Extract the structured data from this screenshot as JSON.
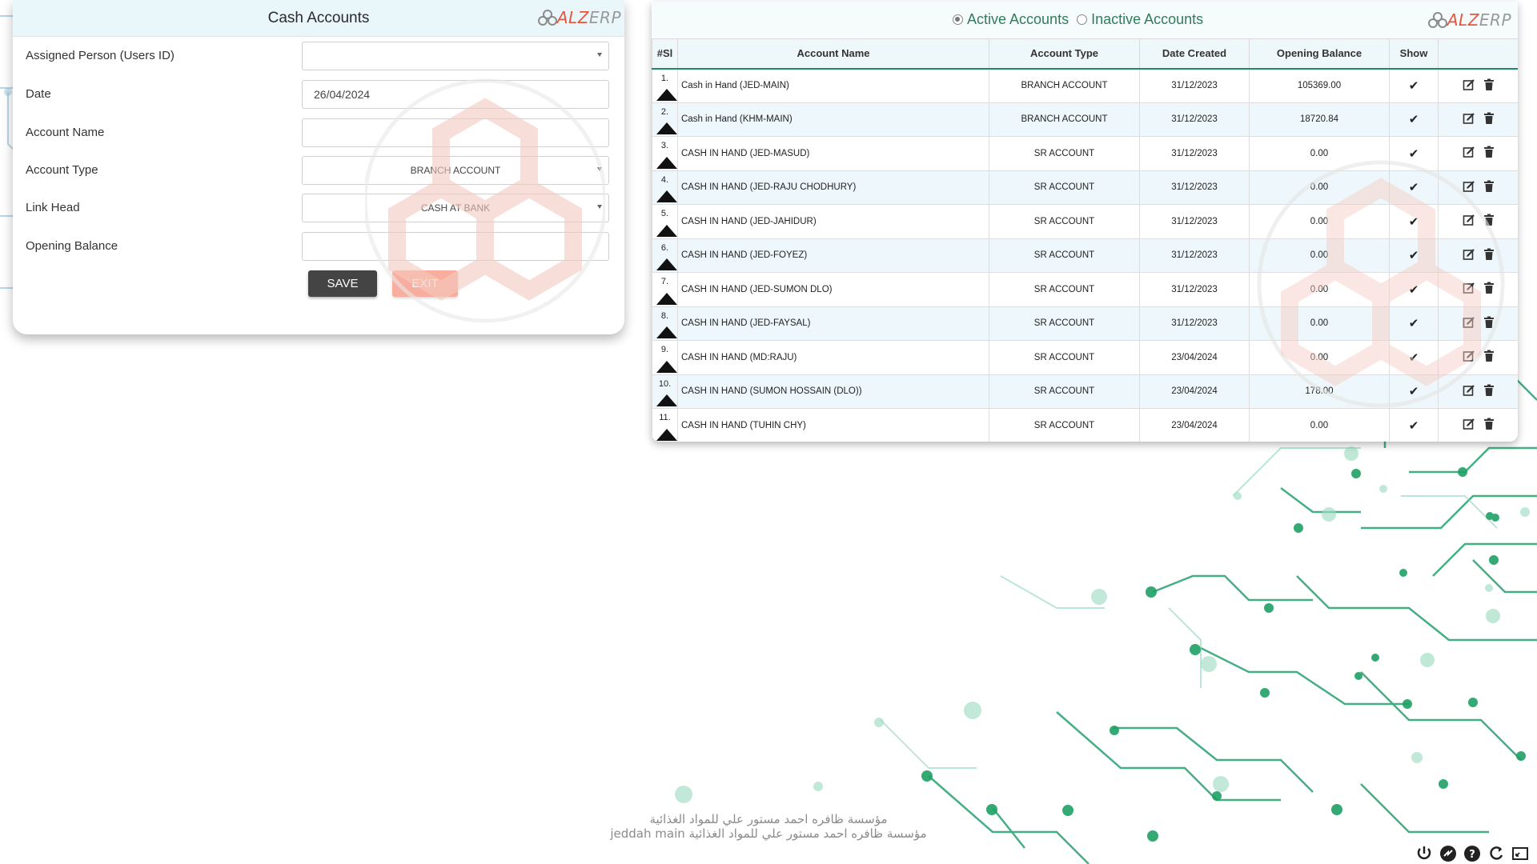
{
  "form": {
    "title": "Cash Accounts",
    "logo": {
      "part1": "ALZ",
      "part2": "ERP"
    },
    "fields": [
      {
        "label": "Assigned Person (Users ID)",
        "value": "",
        "type": "select"
      },
      {
        "label": "Date",
        "value": "26/04/2024",
        "type": "input"
      },
      {
        "label": "Account Name",
        "value": "",
        "type": "input"
      },
      {
        "label": "Account Type",
        "value": "BRANCH ACCOUNT",
        "type": "select"
      },
      {
        "label": "Link Head",
        "value": "CASH AT BANK",
        "type": "select"
      },
      {
        "label": "Opening Balance",
        "value": "",
        "type": "input"
      }
    ],
    "save_label": "SAVE",
    "exit_label": "EXIT"
  },
  "accounts": {
    "filters": {
      "active_label": "Active Accounts",
      "inactive_label": "Inactive Accounts",
      "selected": "active"
    },
    "logo": {
      "part1": "ALZ",
      "part2": "ERP"
    },
    "columns": [
      "#Sl",
      "Account Name",
      "Account Type",
      "Date Created",
      "Opening Balance",
      "Show",
      ""
    ],
    "rows": [
      {
        "sl": "1.",
        "name": "Cash in Hand (JED-MAIN)",
        "type": "BRANCH ACCOUNT",
        "date": "31/12/2023",
        "balance": "105369.00",
        "show": "✔"
      },
      {
        "sl": "2.",
        "name": "Cash in Hand (KHM-MAIN)",
        "type": "BRANCH ACCOUNT",
        "date": "31/12/2023",
        "balance": "18720.84",
        "show": "✔"
      },
      {
        "sl": "3.",
        "name": "CASH IN HAND (JED-MASUD)",
        "type": "SR ACCOUNT",
        "date": "31/12/2023",
        "balance": "0.00",
        "show": "✔"
      },
      {
        "sl": "4.",
        "name": "CASH IN HAND (JED-RAJU CHODHURY)",
        "type": "SR ACCOUNT",
        "date": "31/12/2023",
        "balance": "0.00",
        "show": "✔"
      },
      {
        "sl": "5.",
        "name": "CASH IN HAND (JED-JAHIDUR)",
        "type": "SR ACCOUNT",
        "date": "31/12/2023",
        "balance": "0.00",
        "show": "✔"
      },
      {
        "sl": "6.",
        "name": "CASH IN HAND (JED-FOYEZ)",
        "type": "SR ACCOUNT",
        "date": "31/12/2023",
        "balance": "0.00",
        "show": "✔"
      },
      {
        "sl": "7.",
        "name": "CASH IN HAND (JED-SUMON DLO)",
        "type": "SR ACCOUNT",
        "date": "31/12/2023",
        "balance": "0.00",
        "show": "✔"
      },
      {
        "sl": "8.",
        "name": "CASH IN HAND (JED-FAYSAL)",
        "type": "SR ACCOUNT",
        "date": "31/12/2023",
        "balance": "0.00",
        "show": "✔"
      },
      {
        "sl": "9.",
        "name": "CASH IN HAND (MD:RAJU)",
        "type": "SR ACCOUNT",
        "date": "23/04/2024",
        "balance": "0.00",
        "show": "✔"
      },
      {
        "sl": "10.",
        "name": "CASH IN HAND (SUMON HOSSAIN (DLO))",
        "type": "SR ACCOUNT",
        "date": "23/04/2024",
        "balance": "178.00",
        "show": "✔"
      },
      {
        "sl": "11.",
        "name": "CASH IN HAND (TUHIN CHY)",
        "type": "SR ACCOUNT",
        "date": "23/04/2024",
        "balance": "0.00",
        "show": "✔"
      }
    ]
  },
  "footer": {
    "line1": "مؤسسة ظافره احمد مستور علي للمواد الغذائية",
    "line2": "مؤسسة ظافره احمد مستور علي للمواد الغذائية jeddah main"
  },
  "colors": {
    "accent": "#1f8a6a",
    "brand": "#e9543f",
    "save_button": "#444444",
    "exit_button": "#f7ae9e",
    "header_bg": "#e9f7fb"
  }
}
